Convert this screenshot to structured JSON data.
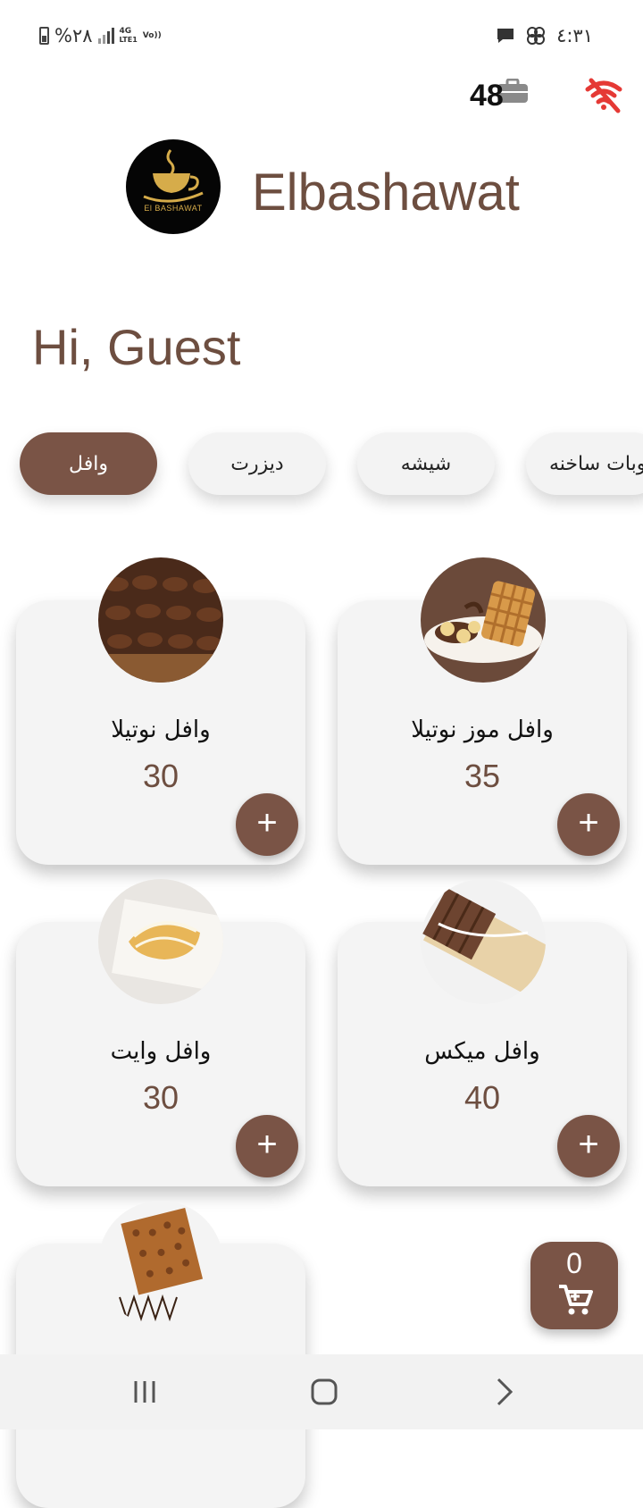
{
  "status_bar": {
    "battery_text": "%٢٨",
    "network_top": "4G",
    "network_bottom": "LTE1",
    "volte_top": "Vo))",
    "time": "٤:٣١"
  },
  "top_bar": {
    "badge_count": "48"
  },
  "header": {
    "logo_text": "El BASHAWAT",
    "brand_name": "Elbashawat"
  },
  "greeting": "Hi, Guest",
  "categories": [
    {
      "label": "وافل",
      "active": true
    },
    {
      "label": "ديزرت",
      "active": false
    },
    {
      "label": "شيشه",
      "active": false
    },
    {
      "label": "مشروبات ساخنه",
      "active": false
    }
  ],
  "products": [
    {
      "name": "وافل موز نوتيلا",
      "price": "35"
    },
    {
      "name": "وافل نوتيلا",
      "price": "30"
    },
    {
      "name": "وافل ميكس",
      "price": "40"
    },
    {
      "name": "وافل وايت",
      "price": "30"
    },
    {
      "name": "",
      "price": ""
    }
  ],
  "add_label": "+",
  "cart": {
    "count": "0"
  },
  "colors": {
    "accent": "#7a5446",
    "brand_text": "#6d4e40",
    "wifi_off": "#e53935"
  }
}
